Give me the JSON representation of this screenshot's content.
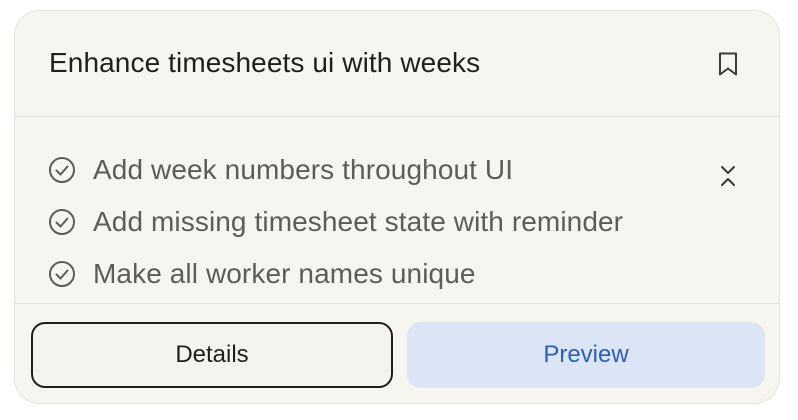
{
  "card": {
    "title": "Enhance timesheets ui with weeks",
    "bookmark_icon": "bookmark-icon",
    "collapse_icon": "chevron-collapse-icon",
    "tasks": [
      {
        "label": "Add week numbers throughout UI",
        "icon": "check-circle-icon"
      },
      {
        "label": "Add missing timesheet state with reminder",
        "icon": "check-circle-icon"
      },
      {
        "label": "Make all worker names unique",
        "icon": "check-circle-icon"
      }
    ],
    "buttons": {
      "details_label": "Details",
      "preview_label": "Preview"
    },
    "colors": {
      "card_background": "#f7f5f0",
      "preview_background": "#dbe5f5",
      "preview_text": "#2f5fa7",
      "details_border": "#1e1e1c"
    }
  }
}
